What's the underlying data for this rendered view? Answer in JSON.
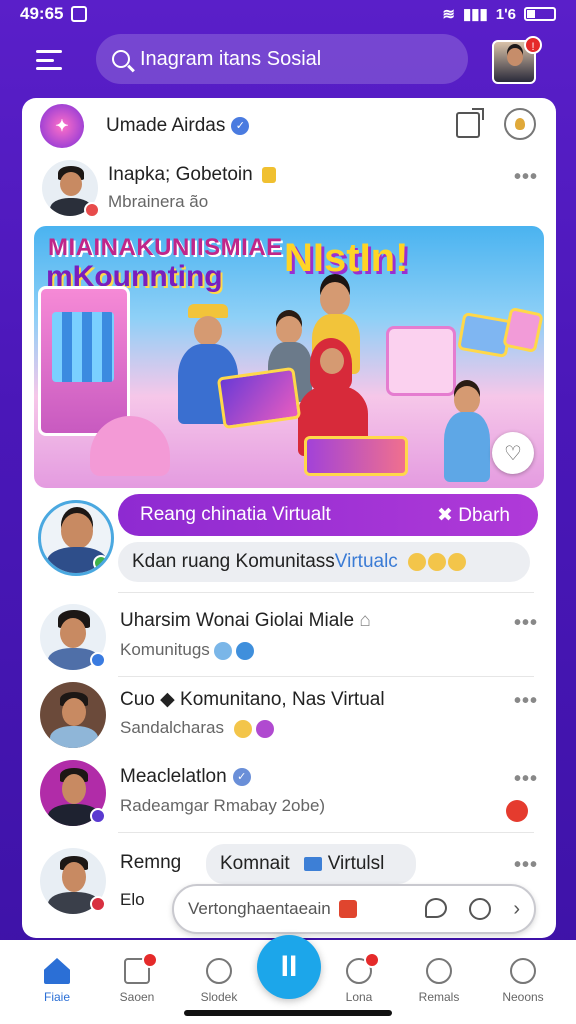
{
  "status_bar": {
    "time": "49:65",
    "right_text": "1ʹ6"
  },
  "header": {
    "search_text": "Inagram itans Sosial",
    "avatar_badge": "!"
  },
  "card_top": {
    "brand_logo_text": "✦",
    "title": "Umade Airdas"
  },
  "post": {
    "name": "Inapka; Gobetoin",
    "subtitle": "Mbrainera ão",
    "more": "•••"
  },
  "banner": {
    "title_line1": "MIAINAKUNIISMIAE",
    "title_line2": "mKounnting",
    "title_big": "NIstIn!",
    "reaction_icon": "♡"
  },
  "feature": {
    "purple_pill": "Reang chinatia Virtualt",
    "purple_pill_action": "✖ Dbarh",
    "grey_pill_prefix": "Kdan ruang Komunitass ",
    "grey_pill_highlight": "Virtualc"
  },
  "rows": [
    {
      "name": "Uharsim Wonai Giolai Miale",
      "subtitle": "Komunitugs",
      "more": "•••"
    },
    {
      "name": "Cuo ◆ Komunitano, Nas Virtual",
      "subtitle": "Sandalcharas",
      "more": "•••"
    },
    {
      "name": "Meaclelatlon",
      "subtitle": "Radeamgar Rmabay 2obe)",
      "more": "•••"
    },
    {
      "name": "Remng",
      "subtitle": "Elo",
      "more": "•••",
      "tag_prefix": "Komnait",
      "tag_suffix": "Virtulsl"
    }
  ],
  "composer": {
    "placeholder": "Vertonghaentaeain"
  },
  "fab": {
    "label": "II"
  },
  "nav": [
    {
      "label": "Fiaie"
    },
    {
      "label": "Saoen"
    },
    {
      "label": "Slodek"
    },
    {
      "label": "Lona"
    },
    {
      "label": "Remals"
    },
    {
      "label": "Neoons"
    }
  ],
  "colors": {
    "primary_purple": "#5a1fc9",
    "accent_blue": "#1ca6ea",
    "pill_purple": "#8e2ad1"
  }
}
